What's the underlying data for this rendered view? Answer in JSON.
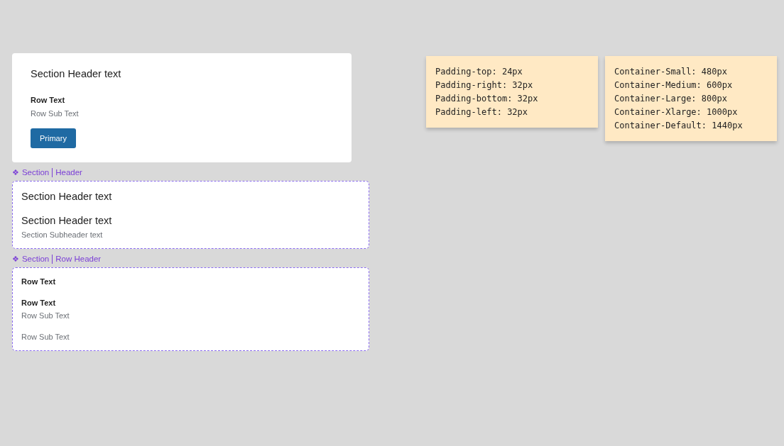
{
  "card": {
    "header": "Section Header text",
    "row_title": "Row Text",
    "row_subtitle": "Row Sub Text",
    "button": "Primary"
  },
  "components": [
    {
      "icon": "❖",
      "label": [
        "Section",
        "Header"
      ],
      "groups": [
        [
          {
            "kind": "header",
            "text": "Section Header text"
          }
        ],
        [
          {
            "kind": "header",
            "text": "Section Header text"
          },
          {
            "kind": "subheader",
            "text": "Section Subheader text"
          }
        ]
      ]
    },
    {
      "icon": "❖",
      "label": [
        "Section",
        "Row Header"
      ],
      "groups": [
        [
          {
            "kind": "row",
            "text": "Row Text"
          }
        ],
        [
          {
            "kind": "row",
            "text": "Row Text"
          },
          {
            "kind": "subrow",
            "text": "Row Sub Text"
          }
        ],
        [
          {
            "kind": "subrow",
            "text": "Row Sub Text"
          }
        ]
      ]
    }
  ],
  "notes": [
    {
      "lines": [
        "Padding-top: 24px",
        "Padding-right: 32px",
        "Padding-bottom: 32px",
        "Padding-left: 32px"
      ]
    },
    {
      "lines": [
        "Container-Small: 480px",
        "Container-Medium: 600px",
        "Container-Large: 800px",
        "Container-Xlarge: 1000px",
        "Container-Default: 1440px"
      ]
    }
  ]
}
